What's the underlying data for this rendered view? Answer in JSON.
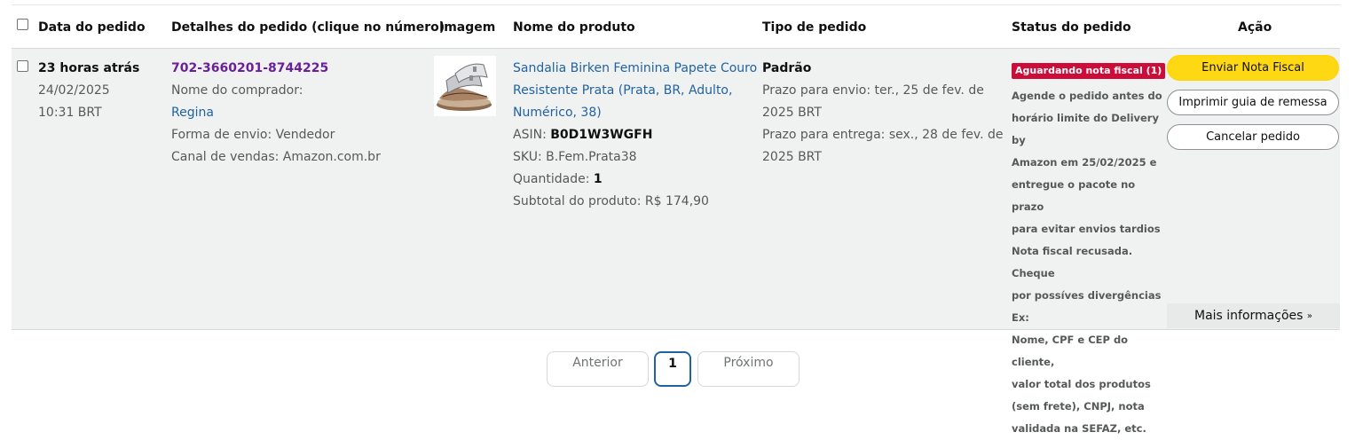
{
  "header": {
    "order_date": "Data do pedido",
    "order_details": "Detalhes do pedido (clique no número)",
    "image": "Imagem",
    "product_name": "Nome do produto",
    "order_type": "Tipo de pedido",
    "order_status": "Status do pedido",
    "action": "Ação"
  },
  "order": {
    "date_relative": "23 horas atrás",
    "date": "24/02/2025",
    "time": "10:31 BRT",
    "order_number": "702-3660201-8744225",
    "buyer_label": "Nome do comprador:",
    "buyer_name": "Regina",
    "shipping": "Forma de envio: Vendedor",
    "channel": "Canal de vendas: Amazon.com.br",
    "product_title_1": "Sandalia Birken Feminina Papete Couro",
    "product_title_2": "Resistente Prata (Prata, BR, Adulto,",
    "product_title_3": "Numérico, 38)",
    "asin_label": "ASIN:",
    "asin": "B0D1W3WGFH",
    "sku": "SKU: B.Fem.Prata38",
    "qty_label": "Quantidade:",
    "qty": "1",
    "subtotal": "Subtotal do produto: R$ 174,90",
    "type": "Padrão",
    "ship_deadline_1": "Prazo para envio: ter., 25 de fev. de",
    "ship_deadline_2": "2025 BRT",
    "delivery_deadline_1": "Prazo para entrega: sex., 28 de fev. de",
    "delivery_deadline_2": "2025 BRT",
    "status_badge": "Aguardando nota fiscal (1)",
    "status_lines": [
      "Agende o pedido antes do",
      "horário limite do Delivery by",
      "Amazon em 25/02/2025 e",
      "entregue o pacote no prazo",
      "para evitar envios tardios",
      "Nota fiscal recusada. Cheque",
      "por possíves divergências Ex:",
      "Nome, CPF e CEP do cliente,",
      "valor total dos produtos",
      "(sem frete), CNPJ, nota",
      "validada na SEFAZ, etc."
    ]
  },
  "actions": {
    "send_invoice": "Enviar Nota Fiscal",
    "print_label": "Imprimir guia de remessa",
    "cancel": "Cancelar pedido",
    "more_info": "Mais informações",
    "more_icon": "double-chevron-down-icon"
  },
  "pagination": {
    "previous": "Anterior",
    "current": "1",
    "next": "Próximo"
  },
  "colors": {
    "badge_red": "#cc0c39",
    "primary_yellow": "#ffd814",
    "link_blue": "#2162a1",
    "order_purple": "#6b1f99"
  }
}
